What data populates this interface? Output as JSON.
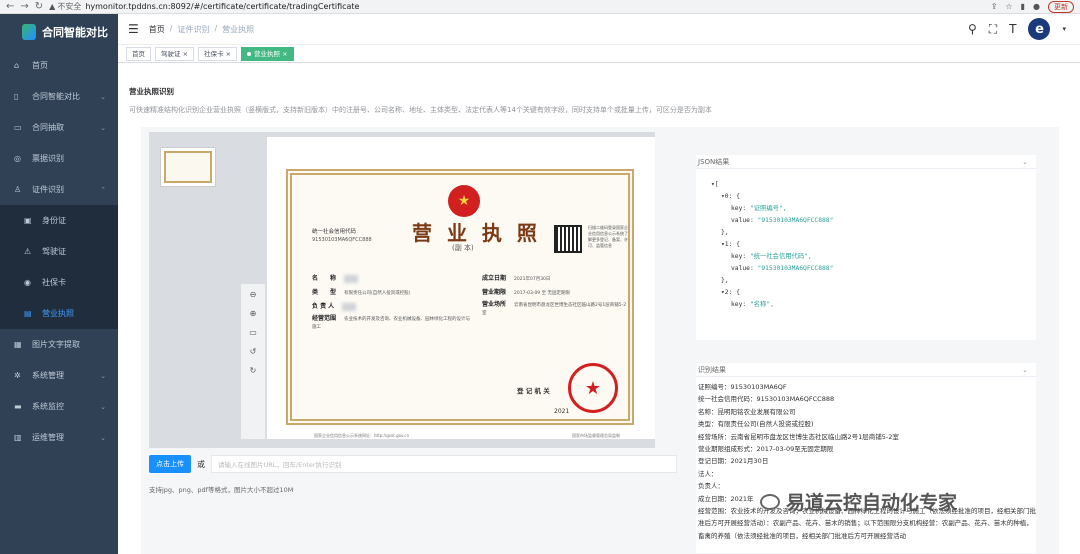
{
  "browser": {
    "insecure_label": "不安全",
    "url": "hymonitor.tpddns.cn:8092/#/certificate/certificate/tradingCertificate",
    "update_label": "更新"
  },
  "sidebar": {
    "brand": "合同智能对比",
    "items": [
      {
        "label": "首页",
        "icon": "home-icon"
      },
      {
        "label": "合同智能对比",
        "icon": "book-icon",
        "arrow": "⌄"
      },
      {
        "label": "合同抽取",
        "icon": "tray-icon",
        "arrow": "⌄"
      },
      {
        "label": "票据识别",
        "icon": "target-icon"
      },
      {
        "label": "证件识别",
        "icon": "person-icon",
        "arrow": "⌃"
      },
      {
        "label": "图片文字提取",
        "icon": "grid-icon"
      },
      {
        "label": "系统管理",
        "icon": "gear-icon",
        "arrow": "⌄"
      },
      {
        "label": "系统监控",
        "icon": "monitor-icon",
        "arrow": "⌄"
      },
      {
        "label": "运维管理",
        "icon": "server-icon",
        "arrow": "⌄"
      }
    ],
    "sub": [
      {
        "label": "身份证",
        "icon": "id-card-icon"
      },
      {
        "label": "驾驶证",
        "icon": "car-icon"
      },
      {
        "label": "社保卡",
        "icon": "card-icon"
      },
      {
        "label": "营业执照",
        "icon": "license-icon"
      }
    ]
  },
  "header": {
    "breadcrumb": [
      "首页",
      "证件识别",
      "营业执照"
    ],
    "sep": "/"
  },
  "tags": [
    {
      "label": "首页"
    },
    {
      "label": "驾驶证 ×"
    },
    {
      "label": "社保卡 ×"
    },
    {
      "label": "营业执照 ×"
    }
  ],
  "page": {
    "title": "营业执照识别",
    "description": "可快速精准结构化识别企业营业执照（竖横版式，支持新旧版本）中的注册号、公司名称、地址、主体类型、法定代表人等14个关键有效字段，同时支持单个或批量上传，可区分是否为副本"
  },
  "certificate": {
    "title": "营 业 执 照",
    "subtitle": "(副 本)",
    "code_label": "统一社会信用代码",
    "code_value": "91530103MA6QFCC888",
    "qr_text": "扫描二维码登录国家企业信用信息公示系统了解更多登记、备案、许可、监管信息",
    "fields": [
      {
        "label": "名　　称",
        "value": ""
      },
      {
        "label": "类　　型",
        "value": "有限责任公司(自然人投资或控股)"
      },
      {
        "label": "负 责 人",
        "value": ""
      },
      {
        "label": "经营范围",
        "value": "农业技术的开发及咨询、农业机械设备、园林绿化工程的设计与施工"
      },
      {
        "label": "成立日期",
        "value": "2021年07月30日"
      },
      {
        "label": "营业期限",
        "value": "2017-03-09 至 无固定期限"
      },
      {
        "label": "营业场所",
        "value": "云南省昆明市盘龙区世博生态社区临山路2号1层商铺5-2室"
      }
    ],
    "reg_label": "登 记 机 关",
    "year": "2021",
    "foot_left": "国家企业信用信息公示系统网址：http://gsxt.gov.cn",
    "foot_right": "国家市场监督管理总局监制"
  },
  "upload": {
    "button": "点击上传",
    "or": "或",
    "placeholder": "请输入在线图片URL，回车/Enter执行识别",
    "hint": "支持jpg、png、pdf等格式，图片大小不超过10M"
  },
  "json_panel": {
    "title": "JSON结果",
    "lines": [
      {
        "t": "▾[",
        "i": 0
      },
      {
        "t": "▾0: {",
        "i": 1
      },
      {
        "k": "key: ",
        "s": "\"证照编号\",",
        "i": 2
      },
      {
        "k": "value: ",
        "s": "\"91530103MA6QFCC888\"",
        "i": 2
      },
      {
        "t": "},",
        "i": 1
      },
      {
        "t": "▾1: {",
        "i": 1
      },
      {
        "k": "key: ",
        "s": "\"统一社会信用代码\",",
        "i": 2
      },
      {
        "k": "value: ",
        "s": "\"91530103MA6QFCC888\"",
        "i": 2
      },
      {
        "t": "},",
        "i": 1
      },
      {
        "t": "▾2: {",
        "i": 1
      },
      {
        "k": "key: ",
        "s": "\"名称\",",
        "i": 2
      }
    ]
  },
  "result_panel": {
    "title": "识别结果",
    "lines": [
      "证照编号：91530103MA6QF",
      "统一社会信用代码：91530103MA6QFCC888",
      "名称：昆明阳铭农业发展有限公司",
      "类型：有限责任公司(自然人投资或控股)",
      "经营场所：云南省昆明市盘龙区世博生态社区临山路2号1层商铺5-2室",
      "营业期限组成形式：2017-03-09至无固定期限",
      "登记日期：2021月30日",
      "法人：",
      "负责人：",
      "成立日期：2021年",
      "经营范围：农业技术的开发及咨询；农业机械设备、园林绿化工程的设计与施工（依法须经批准的项目，经相关部门批准后方可开展经营活动）：农副产品、花卉、苗木的销售；以下范围限分支机构经营：农副产品、花卉、苗木的种植，畜禽的养殖（依法须经批准的项目，经相关部门批准后方可开展经营活动"
    ]
  },
  "watermark": "易道云控自动化专家"
}
